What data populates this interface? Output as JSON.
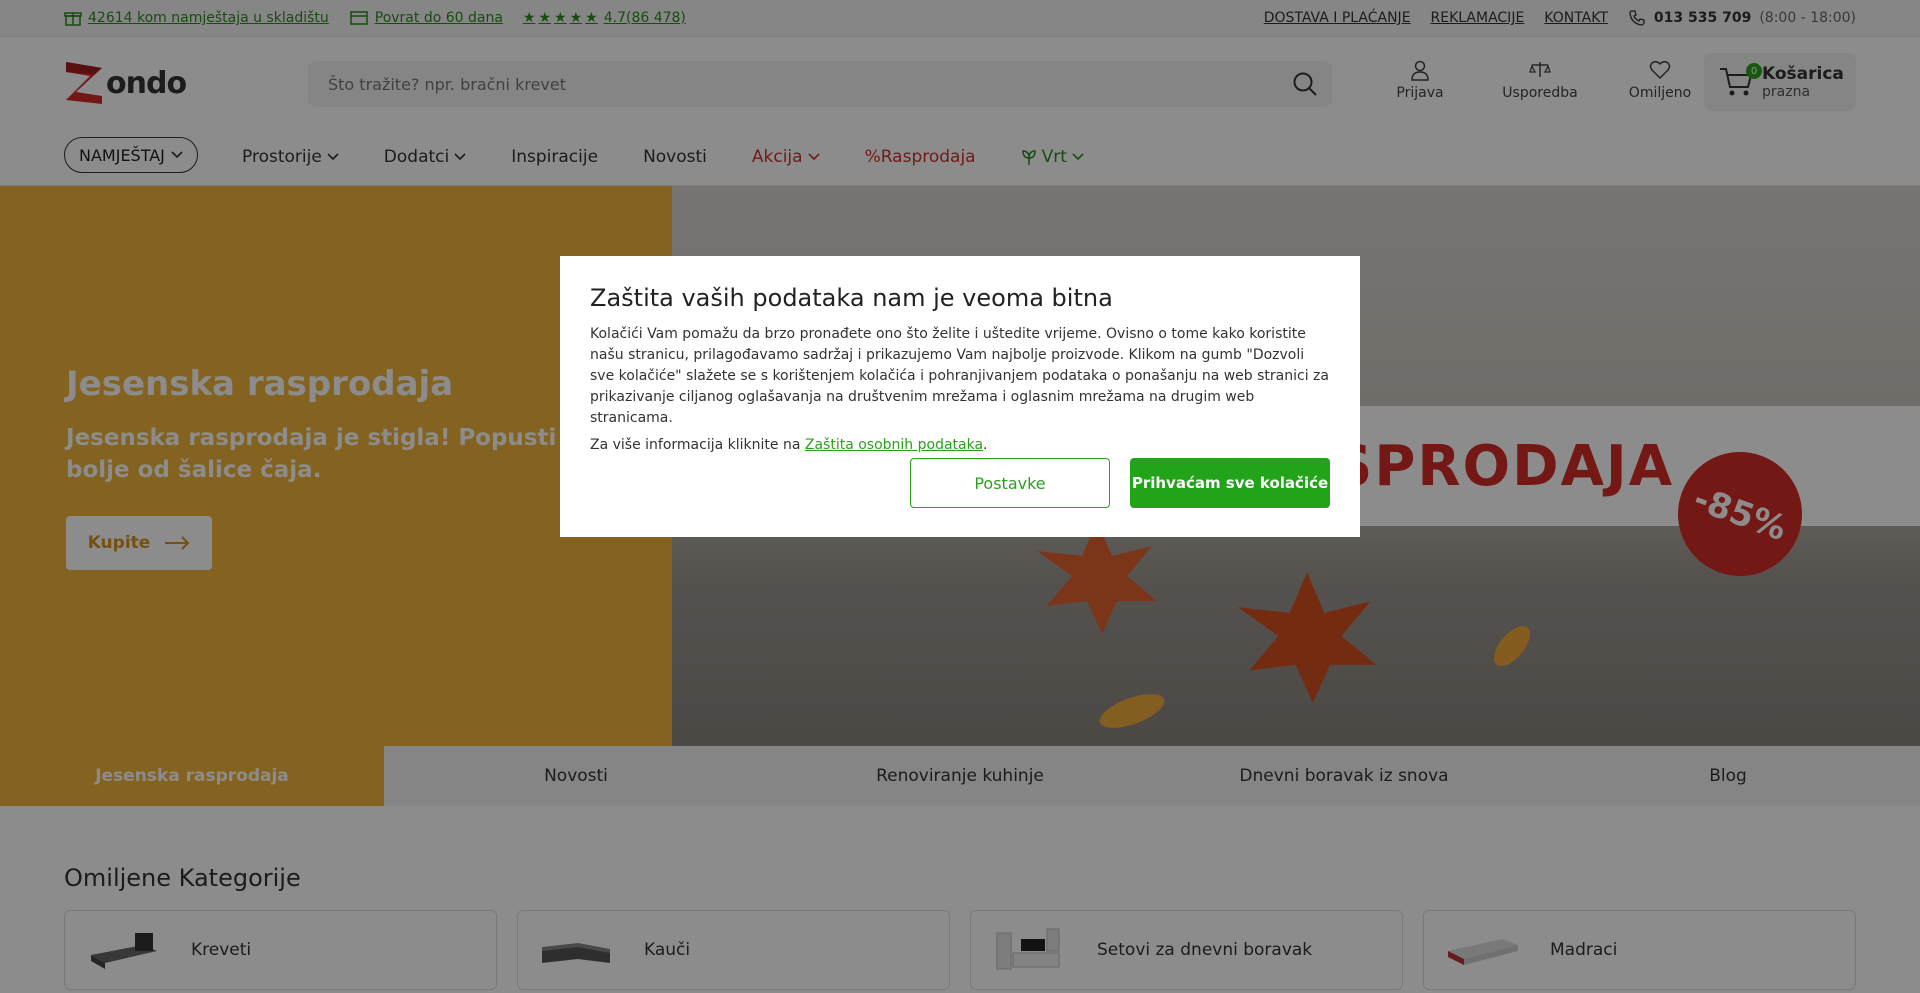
{
  "topbar": {
    "stock": "42614 kom namještaja u skladištu",
    "returns": "Povrat do 60 dana",
    "rating": "4.7(86 478)",
    "links": [
      "DOSTAVA I PLAĆANJE",
      "REKLAMACIJE",
      "KONTAKT"
    ],
    "phone": "013 535 709",
    "hours": "(8:00 - 18:00)"
  },
  "header": {
    "logo": "ondo",
    "search_placeholder": "Što tražite? npr. bračni krevet",
    "icons": [
      "Prijava",
      "Usporedba",
      "Omiljeno"
    ],
    "cart_title": "Košarica",
    "cart_status": "prazna",
    "cart_count": "0"
  },
  "nav": {
    "main": "NAMJEŠTAJ",
    "items": [
      "Prostorije",
      "Dodatci",
      "Inspiracije",
      "Novosti",
      "Akcija",
      "%Rasprodaja",
      "Vrt"
    ]
  },
  "hero": {
    "title": "Jesenska rasprodaja",
    "subtitle": "Jesenska rasprodaja je stigla! Popusti koji g",
    "subtitle2": "bolje od šalice čaja.",
    "button": "Kupite",
    "banner_text": "SPRODAJA",
    "discount": "-85%"
  },
  "tabs": [
    "Jesenska rasprodaja",
    "Novosti",
    "Renoviranje kuhinje",
    "Dnevni boravak iz snova",
    "Blog"
  ],
  "categories": {
    "title": "Omiljene Kategorije",
    "items": [
      "Kreveti",
      "Kauči",
      "Setovi za dnevni boravak",
      "Madraci"
    ]
  },
  "cookie": {
    "title": "Zaštita vaših podataka nam je veoma bitna",
    "body": "Kolačići Vam pomažu da brzo pronađete ono što želite i uštedite vrijeme. Ovisno o tome kako koristite našu stranicu, prilagođavamo sadržaj i prikazujemo Vam najbolje proizvode. Klikom na gumb \"Dozvoli sve kolačiće\" slažete se s korištenjem kolačića i pohranjivanjem podataka o ponašanju na web stranici za prikazivanje ciljanog oglašavanja na društvenim mrežama i oglasnim mrežama na drugim web stranicama.",
    "info_prefix": "Za više informacija kliknite na",
    "info_link": "Zaštita osobnih podataka",
    "settings_button": "Postavke",
    "accept_button": "Prihvaćam sve kolačiće"
  }
}
